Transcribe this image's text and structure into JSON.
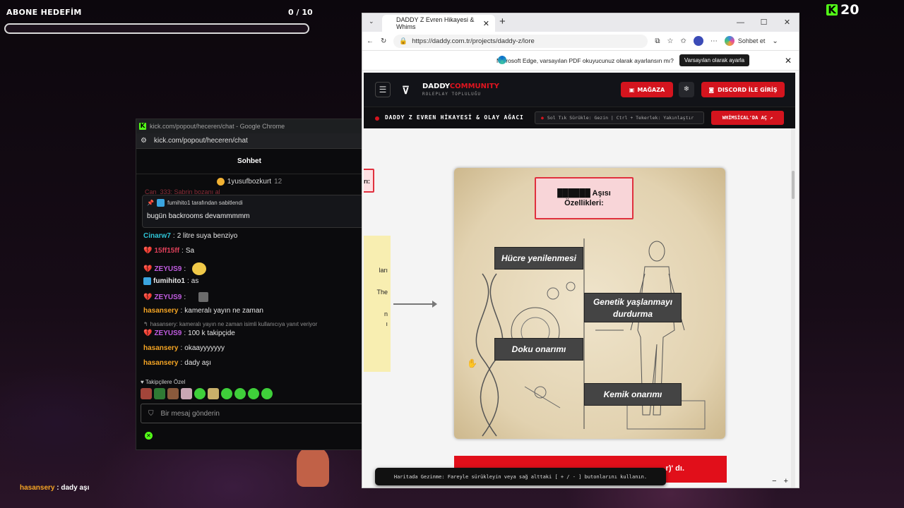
{
  "overlay": {
    "goal_title": "ABONE HEDEFİM",
    "goal_count": "0 / 10",
    "goal_progress": 0,
    "kick_count": "20",
    "kick_logo": "K",
    "bottom_chat": {
      "user": "hasansery",
      "text": " : dady aşı"
    }
  },
  "chat_window": {
    "title": "kick.com/popout/heceren/chat - Google Chrome",
    "url": "kick.com/popout/heceren/chat",
    "tab": "Sohbet",
    "top_gifter": {
      "name": "1yusufbozkurt",
      "count": "12"
    },
    "ghost_line": "Can_333: Sabrin bozanı al",
    "pinned": {
      "by": "fumihito1 tarafından sabitlendi",
      "message": "bugün backrooms devammmmm"
    },
    "messages": [
      {
        "user": "Cinarw7",
        "sep": ":",
        "text": " 2 litre suya benziyo",
        "color": "#2ec4d6",
        "badge": ""
      },
      {
        "user": "15ff15ff",
        "sep": ":",
        "text": " Sa",
        "color": "#e0405a",
        "badge": "heart-icon"
      },
      {
        "user": "ZEYUS9",
        "sep": ":",
        "text": "",
        "color": "#c05ce0",
        "badge": "heart-icon",
        "emote": "smile-emote"
      },
      {
        "user": "fumihito1",
        "sep": ":",
        "text": " as",
        "color": "#e6e6e6",
        "badge": "kick-badge-icon"
      },
      {
        "user": "ZEYUS9",
        "sep": ":",
        "text": "",
        "color": "#c05ce0",
        "badge": "heart-icon",
        "emote": "gif-emote"
      },
      {
        "user": "hasansery",
        "sep": ":",
        "text": " kameralı yayın ne zaman",
        "color": "#f5a524",
        "badge": ""
      },
      {
        "reply": "hasansery: kameralı yayın ne zaman isimli kullanıcıya yanıt veriyor"
      },
      {
        "user": "ZEYUS9",
        "sep": ":",
        "text": " 100 k takipçide",
        "color": "#c05ce0",
        "badge": "heart-icon"
      },
      {
        "user": "hasansery",
        "sep": ":",
        "text": " okaayyyyyyy",
        "color": "#f5a524",
        "badge": ""
      },
      {
        "user": "hasansery",
        "sep": ":",
        "text": " dady aşı",
        "color": "#f5a524",
        "badge": ""
      }
    ],
    "follower_label": "Takipçilere Özel",
    "input_placeholder": "Bir mesaj gönderin"
  },
  "browser": {
    "tab_title": "DADDY Z Evren Hikayesi & Whims",
    "new_tab": "+",
    "url": "https://daddy.com.tr/projects/daddy-z/lore",
    "chat_button": "Sohbet et",
    "infobar_text": "Microsoft Edge, varsayılan PDF okuyucunuz olarak ayarlansın mı?",
    "infobar_button": "Varsayılan olarak ayarla"
  },
  "site": {
    "brand_a": "DADDY",
    "brand_b": "COMMUNITY",
    "brand_sub": "ROLEPLAY TOPLULUĞU",
    "shop": "MAĞAZA",
    "discord": "DISCORD İLE GİRİŞ",
    "lore_title": "DADDY Z EVREN HİKAYESİ & OLAY AĞACI",
    "hint": "Sol Tık Sürükle: Gezin | Ctrl + Tekerlek: Yakınlaştır",
    "whimsical": "WHİMSİCAL'DA AÇ",
    "left_card": "rı:",
    "yellow_lines": [
      "ları",
      "The",
      "n",
      "ı"
    ],
    "card_title_line1": "██████ Aşısı",
    "card_title_line2": "Özellikleri:",
    "labels": {
      "cell": "Hücre yenilenmesi",
      "genetic": "Genetik yaşlanmayı durdurma",
      "tissue": "Doku onarımı",
      "bone": "Kemik onarımı"
    },
    "red_bar": "r)' dı.",
    "toast": "Haritada Gezinme: Fareyle sürükleyin veya sağ alttaki [ + / - ] butonlarını kullanın.",
    "zoom_minus": "−",
    "zoom_plus": "+"
  },
  "colors": {
    "kick_green": "#53fc18",
    "daddy_red": "#d4141e",
    "card_red": "#e0303e"
  }
}
